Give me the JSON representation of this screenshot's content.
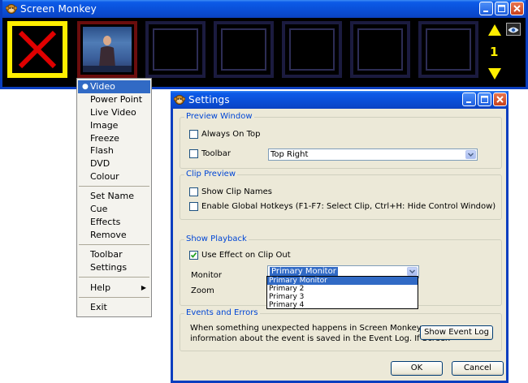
{
  "main_window": {
    "title": "Screen Monkey",
    "page_number": "1"
  },
  "context_menu": {
    "items": [
      {
        "label": "Video",
        "bullet": "●"
      },
      {
        "label": "Power Point"
      },
      {
        "label": "Live Video"
      },
      {
        "label": "Image"
      },
      {
        "label": "Freeze"
      },
      {
        "label": "Flash"
      },
      {
        "label": "DVD"
      },
      {
        "label": "Colour"
      },
      {
        "label": "Set Name"
      },
      {
        "label": "Cue"
      },
      {
        "label": "Effects"
      },
      {
        "label": "Remove"
      },
      {
        "label": "Toolbar"
      },
      {
        "label": "Settings"
      },
      {
        "label": "Help",
        "arrow": "▶"
      },
      {
        "label": "Exit"
      }
    ]
  },
  "settings": {
    "title": "Settings",
    "preview_window": {
      "legend": "Preview Window",
      "always_on_top": "Always On Top",
      "toolbar": "Toolbar",
      "toolbar_position": "Top Right"
    },
    "clip_preview": {
      "legend": "Clip Preview",
      "show_clip_names": "Show Clip Names",
      "enable_hotkeys": "Enable Global Hotkeys (F1-F7: Select Clip, Ctrl+H: Hide Control Window)"
    },
    "show_playback": {
      "legend": "Show Playback",
      "use_effect": "Use Effect on Clip Out",
      "monitor_label": "Monitor",
      "monitor_value": "Primary Monitor",
      "monitor_options": [
        "Primary Monitor",
        "Primary 2",
        "Primary 3",
        "Primary 4"
      ],
      "zoom_label": "Zoom"
    },
    "events": {
      "legend": "Events and Errors",
      "text_line1": "When something unexpected happens in Screen Monkey,",
      "text_line2": "information about the event is saved in the Event Log. If Screen",
      "show_log_button": "Show Event Log"
    },
    "ok_button": "OK",
    "cancel_button": "Cancel"
  },
  "colors": {
    "titlebar": "#0a4fd8",
    "highlight": "#316ac5",
    "selected_slot": "#ffee00",
    "nav_arrows": "#ffee00",
    "legend_text": "#0046d5"
  }
}
